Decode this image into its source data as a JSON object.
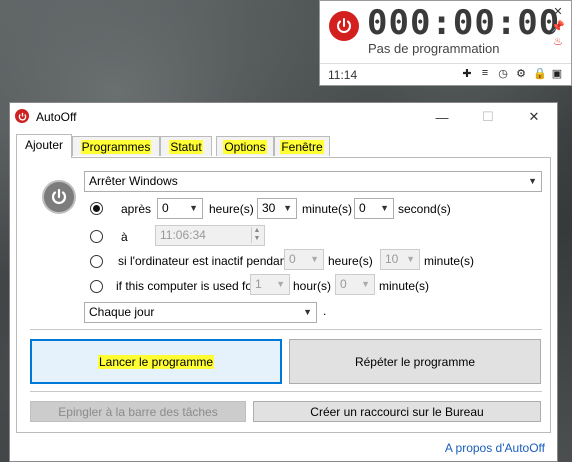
{
  "widget": {
    "timer": "000:00:00",
    "status": "Pas de programmation",
    "clock": "11:14",
    "icons": [
      "close-icon",
      "pin-icon",
      "flame-icon"
    ],
    "bottom_icons": [
      "plus-icon",
      "menu-icon",
      "clock-icon",
      "gear-icon",
      "lock-icon",
      "save-icon"
    ]
  },
  "window": {
    "title": "AutoOff"
  },
  "tabs": [
    "Ajouter",
    "Programmes",
    "Statut",
    "Options",
    "Fenêtre"
  ],
  "form": {
    "action": "Arrêter Windows",
    "after_label": "après",
    "hours_value": "0",
    "hours_label": "heure(s)",
    "minutes_value": "30",
    "minutes_label": "minute(s)",
    "seconds_value": "0",
    "seconds_label": "second(s)",
    "at_label": "à",
    "at_time": "11:06:34",
    "idle_label": "si l'ordinateur est inactif pendant",
    "idle_hours_value": "0",
    "idle_hours_label": "heure(s)",
    "idle_minutes_value": "10",
    "idle_minutes_label": "minute(s)",
    "used_label": "if this computer is used for",
    "used_hours_value": "1",
    "used_hours_label": "hour(s)",
    "used_minutes_value": "0",
    "used_minutes_label": "minute(s)",
    "repeat": "Chaque jour",
    "repeat_suffix": "."
  },
  "buttons": {
    "launch": "Lancer le programme",
    "repeat": "Répéter le programme",
    "pin_taskbar": "Epingler à la barre des tâches",
    "desktop_shortcut": "Créer un raccourci sur le Bureau"
  },
  "about_link": "A propos d'AutoOff"
}
